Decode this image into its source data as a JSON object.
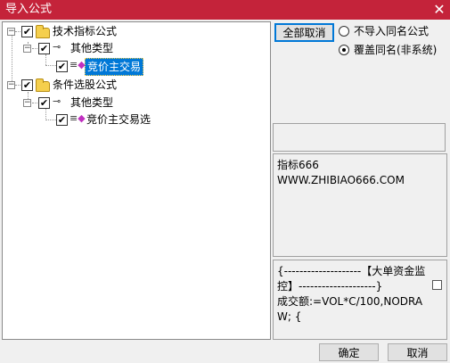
{
  "window": {
    "title": "导入公式",
    "close_glyph": "✕"
  },
  "tree": {
    "nodes": [
      {
        "label": "技术指标公式"
      },
      {
        "label": "其他类型"
      },
      {
        "label": "竞价主交易"
      },
      {
        "label": "条件选股公式"
      },
      {
        "label": "其他类型"
      },
      {
        "label": "竞价主交易选"
      }
    ],
    "checkmark": "✔",
    "expander_glyph": "−"
  },
  "options": {
    "deselect_all_label": "全部取消",
    "radio_no_import_label": "不导入同名公式",
    "radio_overwrite_label": "覆盖同名(非系统)",
    "selected": "overwrite"
  },
  "info": {
    "line1": "指标666",
    "line2": "WWW.ZHIBIAO666.COM"
  },
  "code": {
    "text": "{--------------------【大单资金监控】--------------------}\n成交额:=VOL*C/100,NODRAW; {"
  },
  "footer": {
    "ok_label": "确定",
    "cancel_label": "取消"
  },
  "icons": {
    "folder": "folder-icon",
    "formula_type": "key-icon",
    "formula": "formula-gem-icon",
    "gem_accent": "#c030c0",
    "title_bar_color": "#c4233a",
    "selection_color": "#0078d7"
  }
}
